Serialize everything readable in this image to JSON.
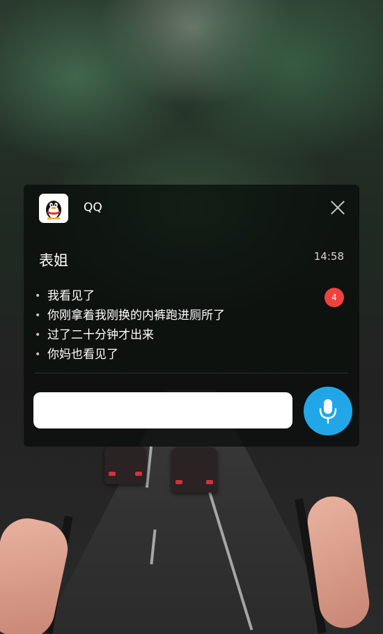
{
  "notification": {
    "app_name": "QQ",
    "app_icon": "qq-penguin-icon",
    "sender": "表姐",
    "time": "14:58",
    "unread_count": "4",
    "messages": [
      "我看见了",
      "你刚拿着我刚换的内裤跑进厕所了",
      "过了二十分钟才出来",
      "你妈也看见了"
    ],
    "reply_placeholder": "",
    "voice_icon": "microphone-icon",
    "close_icon": "close-icon"
  },
  "colors": {
    "badge": "#f0413d",
    "voice_button": "#21a7e8",
    "card_background": "rgba(8,12,10,0.74)"
  }
}
